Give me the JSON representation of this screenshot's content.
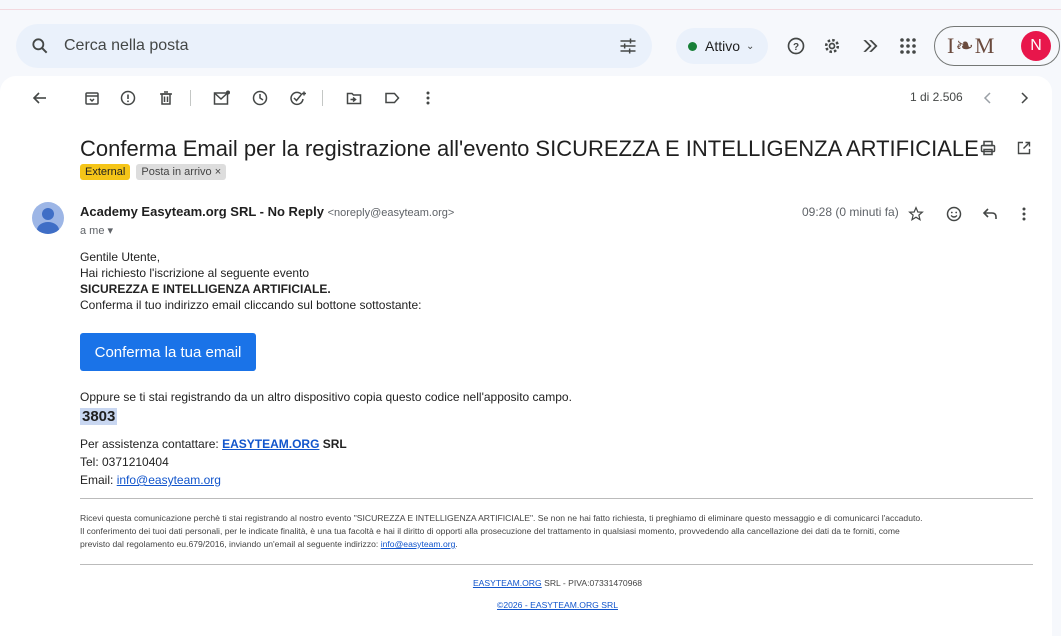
{
  "search": {
    "placeholder": "Cerca nella posta"
  },
  "status": {
    "label": "Attivo"
  },
  "account": {
    "logo_text": "I❧M",
    "avatar_letter": "N"
  },
  "toolbar": {
    "page_count": "1 di 2.506"
  },
  "email": {
    "subject": "Conferma Email per la registrazione all'evento SICUREZZA E INTELLIGENZA ARTIFICIALE",
    "labels": {
      "external": "External",
      "inbox": "Posta in arrivo ×"
    },
    "sender_name": "Academy Easyteam.org SRL - No Reply",
    "sender_addr": "<noreply@easyteam.org>",
    "to": "a me ▾",
    "time": "09:28 (0 minuti fa)",
    "greeting": "Gentile Utente,",
    "line1": "Hai richiesto l'iscrizione al seguente evento",
    "event": "SICUREZZA E INTELLIGENZA ARTIFICIALE.",
    "line2": "Conferma il tuo indirizzo email cliccando sul bottone sottostante:",
    "button": "Conferma la tua email",
    "alt_text": "Oppure se ti stai registrando da un altro dispositivo copia questo codice nell'apposito campo.",
    "code": "3803",
    "assist_prefix": "Per assistenza contattare: ",
    "assist_link": "EASYTEAM.ORG",
    "assist_suffix": " SRL",
    "tel": "Tel: 0371210404",
    "email_prefix": "Email: ",
    "email_link": "info@easyteam.org",
    "disclaimer1": "Ricevi questa comunicazione perchè ti stai registrando al nostro evento \"SICUREZZA E INTELLIGENZA ARTIFICIALE\". Se non ne hai fatto richiesta, ti preghiamo di eliminare questo messaggio e di comunicarci l'accaduto.",
    "disclaimer2": "Il conferimento dei tuoi dati personali, per le indicate finalità, è una tua facoltà e hai il diritto di opporti alla prosecuzione del trattamento in qualsiasi momento, provvedendo alla cancellazione dei dati da te forniti, come",
    "disclaimer3_prefix": "previsto dal regolamento eu.679/2016, inviando un'email al seguente indirizzo: ",
    "disclaimer3_link": "info@easyteam.org",
    "disclaimer3_suffix": ".",
    "footer_link": "EASYTEAM.ORG",
    "footer_rest": " SRL - PIVA:07331470968",
    "copyright": "©2026 - EASYTEAM.ORG SRL"
  }
}
